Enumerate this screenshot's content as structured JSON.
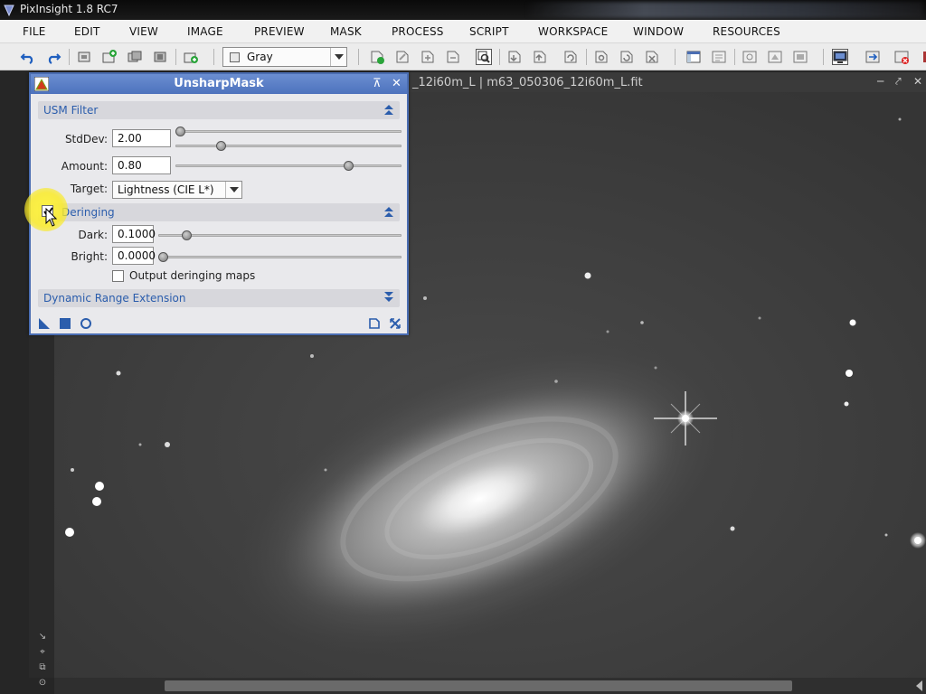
{
  "app": {
    "title": "PixInsight 1.8 RC7"
  },
  "menu": [
    "FILE",
    "EDIT",
    "VIEW",
    "IMAGE",
    "PREVIEW",
    "MASK",
    "PROCESS",
    "SCRIPT",
    "WORKSPACE",
    "WINDOW",
    "RESOURCES"
  ],
  "toolbar": {
    "color_mode_value": "Gray"
  },
  "image_window": {
    "title": "_12i60m_L | m63_050306_12i60m_L.fit"
  },
  "dialog": {
    "title": "UnsharpMask",
    "usm_section": {
      "label": "USM Filter",
      "stddev_label": "StdDev:",
      "stddev_value": "2.00",
      "amount_label": "Amount:",
      "amount_value": "0.80",
      "target_label": "Target:",
      "target_value": "Lightness (CIE L*)"
    },
    "deringing_section": {
      "label": "Deringing",
      "enabled": true,
      "dark_label": "Dark:",
      "dark_value": "0.1000",
      "bright_label": "Bright:",
      "bright_value": "0.0000",
      "output_maps_label": "Output deringing maps",
      "output_maps_checked": false
    },
    "dre_section": {
      "label": "Dynamic Range Extension"
    }
  },
  "colors": {
    "dialog_border": "#4a6db2",
    "section_text": "#2b5dac",
    "cursor_highlight": "#f5e83a"
  }
}
